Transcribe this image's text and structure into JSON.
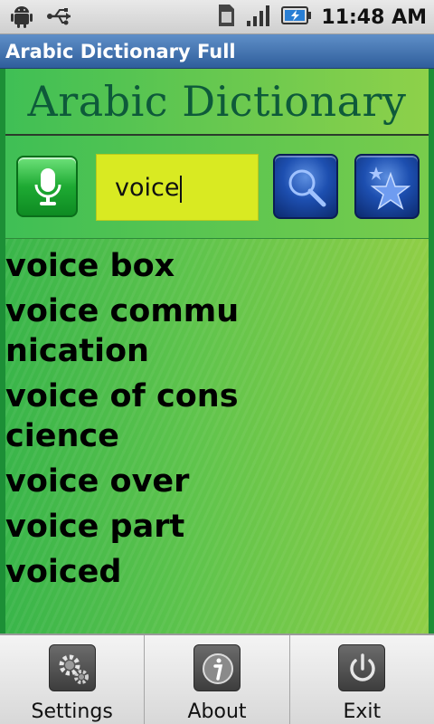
{
  "status_bar": {
    "time": "11:48 AM",
    "icons": [
      "android-icon",
      "usb-icon",
      "sim-icon",
      "signal-icon",
      "battery-icon"
    ]
  },
  "app": {
    "title": "Arabic Dictionary Full"
  },
  "banner": {
    "title": "Arabic Dictionary"
  },
  "search": {
    "value": "voice"
  },
  "results": [
    "voice box",
    "voice communication",
    "voice of conscience",
    "voice over",
    "voice part",
    "voiced"
  ],
  "menu": {
    "items": [
      {
        "label": "Settings",
        "icon": "gear-icon"
      },
      {
        "label": "About",
        "icon": "info-icon"
      },
      {
        "label": "Exit",
        "icon": "power-icon"
      }
    ]
  },
  "colors": {
    "accent_green": "#39b54a",
    "search_field": "#d9ea22",
    "title_bar": "#2f5e9b"
  }
}
